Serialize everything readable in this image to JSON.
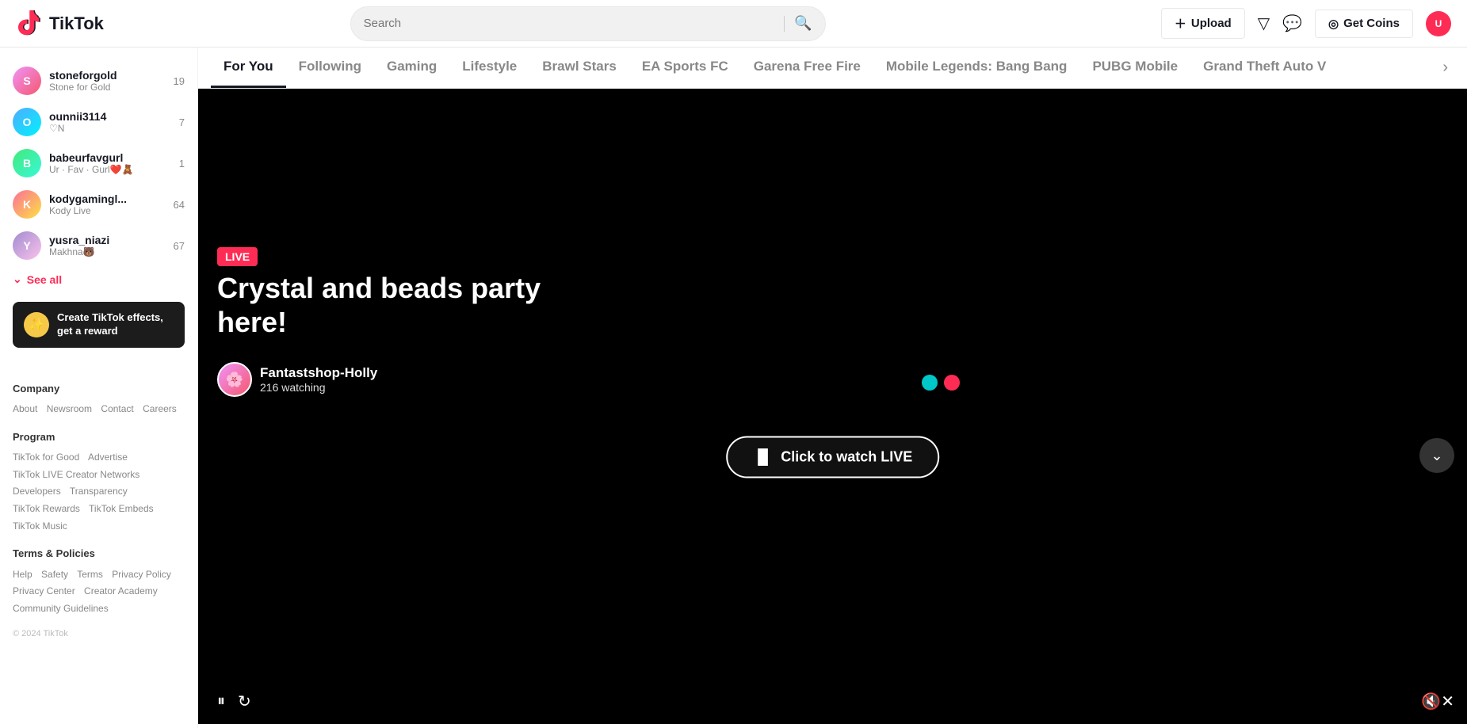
{
  "header": {
    "logo_text": "TikTok",
    "search_placeholder": "Search",
    "upload_label": "Upload",
    "get_coins_label": "Get Coins"
  },
  "tabs": {
    "items": [
      {
        "id": "for-you",
        "label": "For You",
        "active": true
      },
      {
        "id": "following",
        "label": "Following",
        "active": false
      },
      {
        "id": "gaming",
        "label": "Gaming",
        "active": false
      },
      {
        "id": "lifestyle",
        "label": "Lifestyle",
        "active": false
      },
      {
        "id": "brawl-stars",
        "label": "Brawl Stars",
        "active": false
      },
      {
        "id": "ea-sports-fc",
        "label": "EA Sports FC",
        "active": false
      },
      {
        "id": "garena-free-fire",
        "label": "Garena Free Fire",
        "active": false
      },
      {
        "id": "mobile-legends",
        "label": "Mobile Legends: Bang Bang",
        "active": false
      },
      {
        "id": "pubg-mobile",
        "label": "PUBG Mobile",
        "active": false
      },
      {
        "id": "grand-theft-auto",
        "label": "Grand Theft Auto V",
        "active": false
      }
    ]
  },
  "sidebar": {
    "following": [
      {
        "id": "stoneforgold",
        "name": "stoneforgold",
        "handle": "Stone for Gold",
        "count": 19,
        "initials": "S"
      },
      {
        "id": "ounnii3114",
        "name": "ounnii3114",
        "handle": "♡N",
        "count": 7,
        "initials": "O"
      },
      {
        "id": "babeurfavgurl",
        "name": "babeurfavgurl",
        "handle": "Ur · Fav · Gurl❤️🧸",
        "count": 1,
        "initials": "B"
      },
      {
        "id": "kodygamingl",
        "name": "kodygamingl...",
        "handle": "Kody Live",
        "count": 64,
        "initials": "K"
      },
      {
        "id": "yusra_niazi",
        "name": "yusra_niazi",
        "handle": "Makhna🐻",
        "count": 67,
        "initials": "Y"
      }
    ],
    "see_all_label": "See all",
    "effects_banner": {
      "title": "Create TikTok effects, get a reward"
    },
    "footer": {
      "company_title": "Company",
      "company_links": [
        "About",
        "Newsroom",
        "Contact",
        "Careers"
      ],
      "program_title": "Program",
      "program_links": [
        "TikTok for Good",
        "Advertise",
        "TikTok LIVE Creator Networks",
        "Developers",
        "Transparency",
        "TikTok Rewards",
        "TikTok Embeds",
        "TikTok Music"
      ],
      "terms_title": "Terms & Policies",
      "terms_links": [
        "Help",
        "Safety",
        "Terms",
        "Privacy Policy",
        "Privacy Center",
        "Creator Academy",
        "Community Guidelines"
      ],
      "copyright": "© 2024 TikTok"
    }
  },
  "live_stream": {
    "live_badge": "LIVE",
    "title": "Crystal and beads party here!",
    "streamer_name": "Fantastshop-Holly",
    "watching": "216 watching",
    "watch_btn_label": "Click to watch LIVE"
  }
}
